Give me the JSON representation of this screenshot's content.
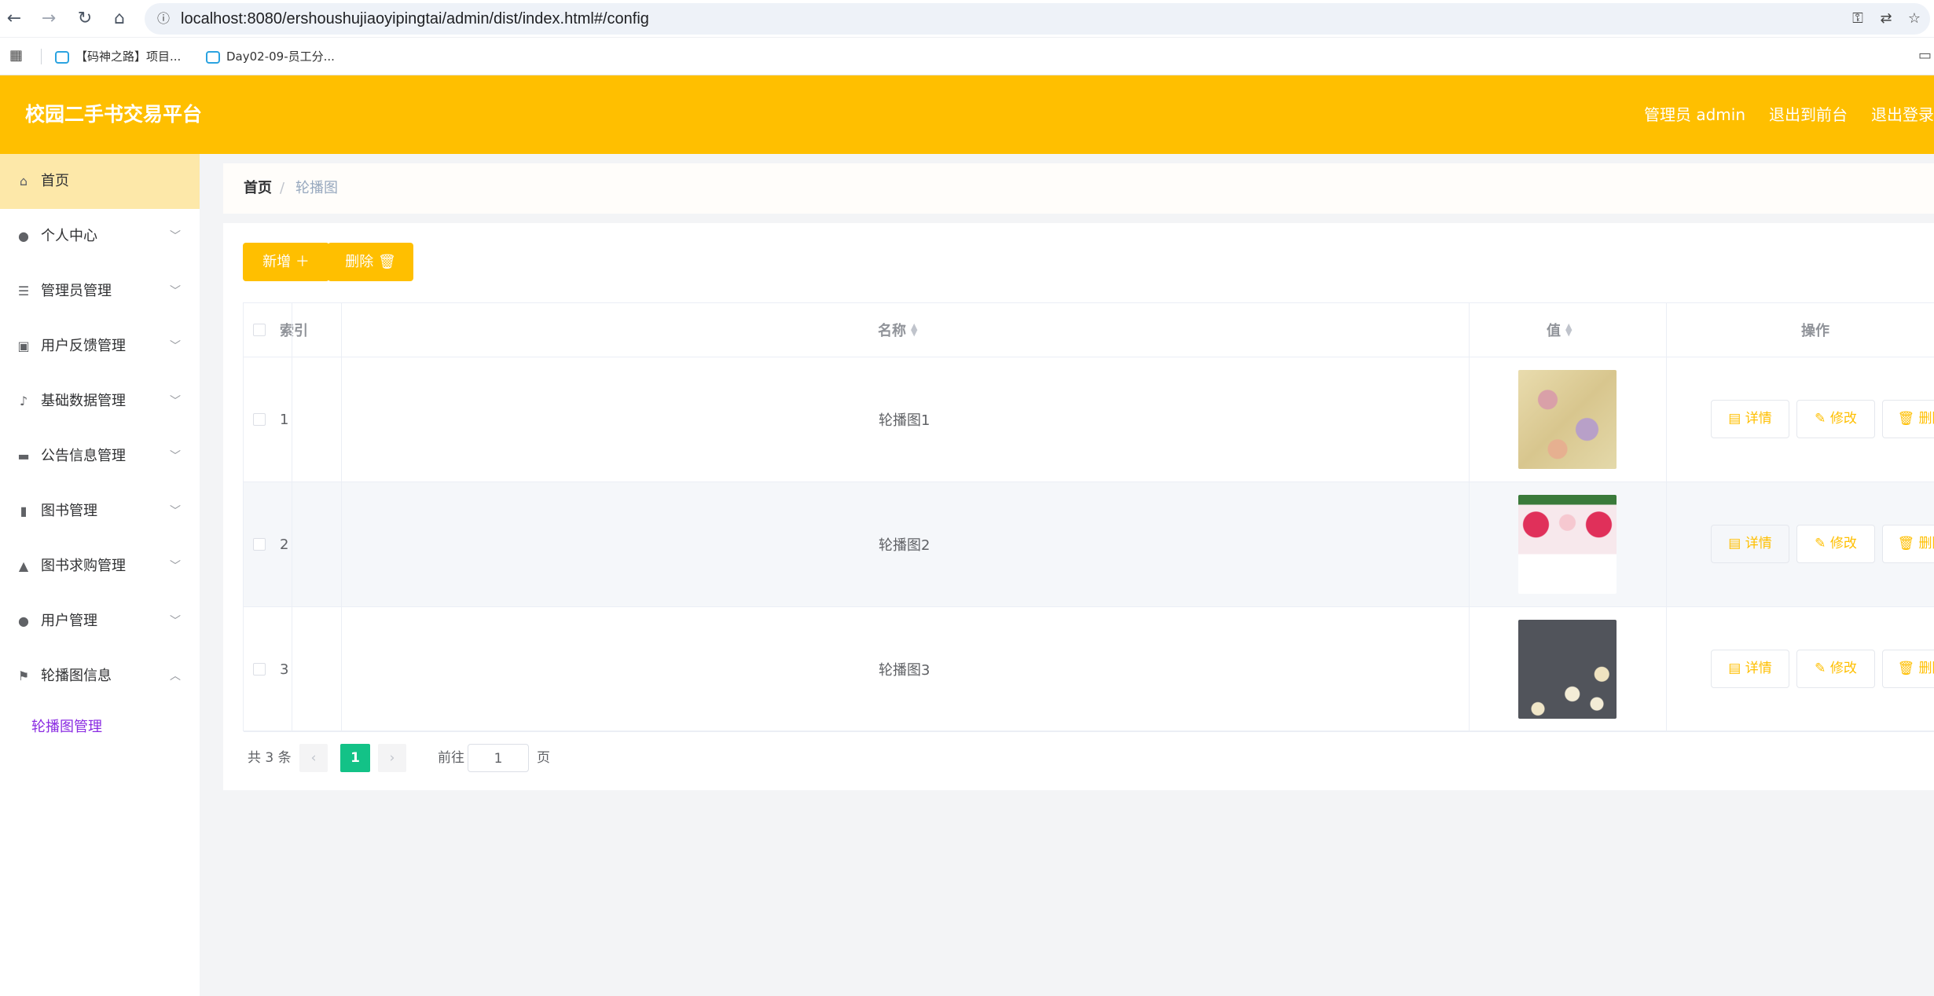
{
  "browser": {
    "url": "localhost:8080/ershoushujiaoyipingtai/admin/dist/index.html#/config",
    "bookmarks": [
      "【码神之路】项目...",
      "Day02-09-员工分..."
    ]
  },
  "header": {
    "title": "校园二手书交易平台",
    "user_label": "管理员 admin",
    "to_front_label": "退出到前台",
    "logout_label": "退出登录"
  },
  "sidebar": {
    "items": [
      {
        "label": "首页",
        "icon": "home-icon"
      },
      {
        "label": "个人中心",
        "icon": "user-icon"
      },
      {
        "label": "管理员管理",
        "icon": "sliders-icon"
      },
      {
        "label": "用户反馈管理",
        "icon": "clipboard-icon"
      },
      {
        "label": "基础数据管理",
        "icon": "bell-off-icon"
      },
      {
        "label": "公告信息管理",
        "icon": "ticket-icon"
      },
      {
        "label": "图书管理",
        "icon": "bar-chart-icon"
      },
      {
        "label": "图书求购管理",
        "icon": "user-cart-icon"
      },
      {
        "label": "用户管理",
        "icon": "lightbulb-icon"
      },
      {
        "label": "轮播图信息",
        "icon": "flag-icon"
      }
    ],
    "sub_item": "轮播图管理"
  },
  "breadcrumb": {
    "home": "首页",
    "separator": "/",
    "current": "轮播图"
  },
  "toolbar": {
    "add_label": "新增",
    "delete_label": "删除"
  },
  "table": {
    "headers": {
      "index": "索引",
      "name": "名称",
      "value": "值",
      "actions": "操作"
    },
    "rows": [
      {
        "index": "1",
        "name": "轮播图1"
      },
      {
        "index": "2",
        "name": "轮播图2"
      },
      {
        "index": "3",
        "name": "轮播图3"
      }
    ],
    "actions": {
      "detail": "详情",
      "edit": "修改",
      "delete": "删除"
    }
  },
  "pagination": {
    "total_text": "共 3 条",
    "current_page": "1",
    "goto_label": "前往",
    "page_input": "1",
    "page_unit": "页"
  },
  "colors": {
    "primary": "#ffbf00",
    "active_page": "#13c287",
    "sub_menu": "#8a2be2"
  }
}
